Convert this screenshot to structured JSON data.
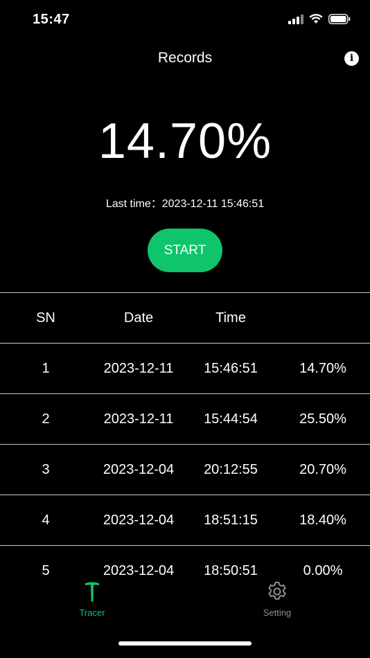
{
  "status_bar": {
    "time": "15:47"
  },
  "nav": {
    "title": "Records",
    "info_icon": "info-icon"
  },
  "summary": {
    "percent": "14.70%",
    "last_time": "Last time：2023-12-11 15:46:51",
    "start_label": "START"
  },
  "table": {
    "headers": {
      "sn": "SN",
      "date": "Date",
      "time": "Time",
      "value": ""
    },
    "rows": [
      {
        "sn": "1",
        "date": "2023-12-11",
        "time": "15:46:51",
        "value": "14.70%"
      },
      {
        "sn": "2",
        "date": "2023-12-11",
        "time": "15:44:54",
        "value": "25.50%"
      },
      {
        "sn": "3",
        "date": "2023-12-04",
        "time": "20:12:55",
        "value": "20.70%"
      },
      {
        "sn": "4",
        "date": "2023-12-04",
        "time": "18:51:15",
        "value": "18.40%"
      },
      {
        "sn": "5",
        "date": "2023-12-04",
        "time": "18:50:51",
        "value": "0.00%"
      }
    ]
  },
  "tabbar": {
    "tabs": [
      {
        "label": "Tracer",
        "icon": "tracer-t-icon",
        "active": true
      },
      {
        "label": "Setting",
        "icon": "gear-icon",
        "active": false
      }
    ]
  },
  "colors": {
    "accent": "#0fc56b",
    "background": "#000000",
    "divider": "#c8c8c8",
    "inactive_tab": "#8e8e8e"
  }
}
